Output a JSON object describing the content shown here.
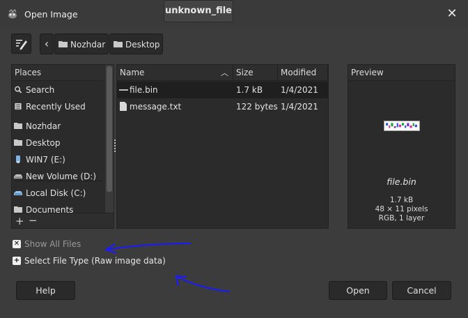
{
  "window": {
    "title": "Open Image"
  },
  "path_bar": {
    "crumbs": [
      "Nozhdar",
      "Desktop"
    ],
    "current": "unknown_file"
  },
  "places": {
    "header": "Places",
    "items": [
      {
        "label": "Search",
        "icon": "search-icon"
      },
      {
        "label": "Recently Used",
        "icon": "recent-icon"
      },
      {
        "label": "Nozhdar",
        "icon": "folder-icon"
      },
      {
        "label": "Desktop",
        "icon": "folder-icon"
      },
      {
        "label": "WIN7 (E:)",
        "icon": "usb-drive-icon"
      },
      {
        "label": "New Volume (D:)",
        "icon": "drive-icon"
      },
      {
        "label": "Local Disk (C:)",
        "icon": "drive-icon"
      },
      {
        "label": "Documents",
        "icon": "folder-icon"
      }
    ]
  },
  "file_list": {
    "columns": {
      "name": "Name",
      "size": "Size",
      "modified": "Modified"
    },
    "rows": [
      {
        "name": "file.bin",
        "size": "1.7 kB",
        "modified": "1/4/2021",
        "selected": true
      },
      {
        "name": "message.txt",
        "size": "122 bytes",
        "modified": "1/4/2021",
        "selected": false
      }
    ]
  },
  "preview": {
    "header": "Preview",
    "name": "file.bin",
    "size": "1.7 kB",
    "dimensions": "48 × 11 pixels",
    "layers": "RGB, 1 layer"
  },
  "options": {
    "show_all": "Show All Files",
    "file_type": "Select File Type (Raw image data)"
  },
  "buttons": {
    "help": "Help",
    "open": "Open",
    "cancel": "Cancel"
  },
  "colors": {
    "background": "#3c3c3c",
    "panel": "#2b2b2b",
    "annotation": "#1a1aff"
  }
}
